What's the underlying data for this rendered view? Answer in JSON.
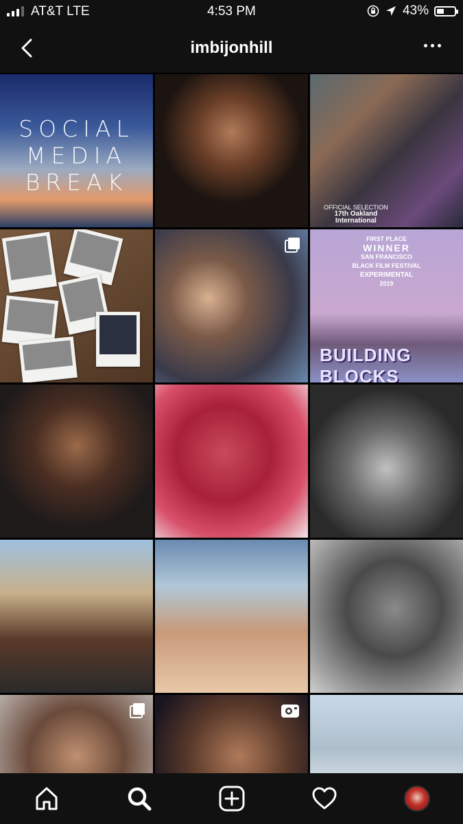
{
  "status_bar": {
    "carrier": "AT&T LTE",
    "time": "4:53 PM",
    "battery": "43%",
    "battery_level": 0.43
  },
  "header": {
    "title": "imbijonhill"
  },
  "tiles": {
    "social_media_break": [
      "SOCIAL",
      "MEDIA",
      "BREAK"
    ],
    "festival_badge": [
      "OFFICIAL SELECTION",
      "17th Oakland",
      "International"
    ],
    "award_laurel": [
      "FIRST PLACE",
      "WINNER",
      "SAN FRANCISCO",
      "BLACK FILM FESTIVAL",
      "EXPERIMENTAL",
      "2019"
    ],
    "building_blocks": "BUILDING BLOCKS"
  },
  "icons": {
    "back": "chevron-left-icon",
    "more": "more-horizontal-icon",
    "carousel": "multiple-posts-icon",
    "video": "video-camera-icon",
    "home": "home-icon",
    "search": "search-icon",
    "new_post": "add-post-icon",
    "activity": "heart-icon",
    "profile": "profile-avatar"
  }
}
